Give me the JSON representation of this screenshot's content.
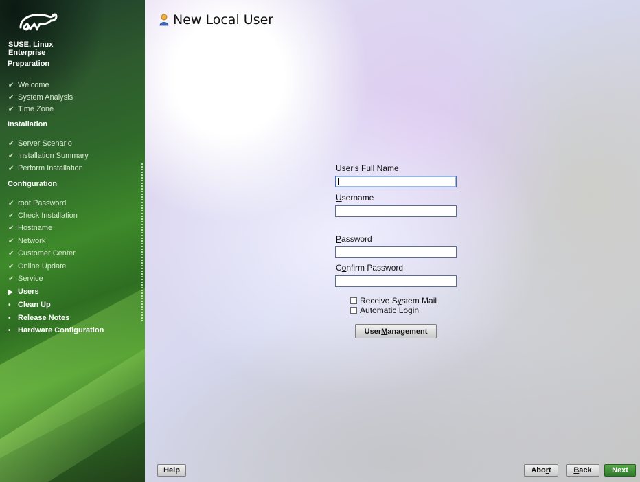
{
  "brand": {
    "line1": "SUSE. Linux",
    "line2": "Enterprise"
  },
  "sidebar": {
    "sections": [
      {
        "title": "Preparation",
        "steps": [
          {
            "label": "Welcome",
            "state": "done"
          },
          {
            "label": "System Analysis",
            "state": "done"
          },
          {
            "label": "Time Zone",
            "state": "done"
          }
        ]
      },
      {
        "title": "Installation",
        "steps": [
          {
            "label": "Server Scenario",
            "state": "done"
          },
          {
            "label": "Installation Summary",
            "state": "done"
          },
          {
            "label": "Perform Installation",
            "state": "done"
          }
        ]
      },
      {
        "title": "Configuration",
        "steps": [
          {
            "label": "root Password",
            "state": "done"
          },
          {
            "label": "Check Installation",
            "state": "done"
          },
          {
            "label": "Hostname",
            "state": "done"
          },
          {
            "label": "Network",
            "state": "done"
          },
          {
            "label": "Customer Center",
            "state": "done"
          },
          {
            "label": "Online Update",
            "state": "done"
          },
          {
            "label": "Service",
            "state": "done"
          },
          {
            "label": "Users",
            "state": "current"
          },
          {
            "label": "Clean Up",
            "state": "pending"
          },
          {
            "label": "Release Notes",
            "state": "pending"
          },
          {
            "label": "Hardware Configuration",
            "state": "pending"
          }
        ]
      }
    ],
    "marks": {
      "done": "✔",
      "current": "▶",
      "pending": "•"
    }
  },
  "page": {
    "title": "New Local User",
    "icon": "user-icon"
  },
  "form": {
    "full_name": {
      "label_pre": "User's ",
      "label_mnemonic": "F",
      "label_post": "ull Name",
      "value": ""
    },
    "username": {
      "label_pre": "",
      "label_mnemonic": "U",
      "label_post": "sername",
      "value": ""
    },
    "password": {
      "label_pre": "",
      "label_mnemonic": "P",
      "label_post": "assword",
      "value": ""
    },
    "confirm_password": {
      "label_pre": "C",
      "label_mnemonic": "o",
      "label_post": "nfirm Password",
      "value": ""
    },
    "receive_mail": {
      "label_pre": "Receive S",
      "label_mnemonic": "y",
      "label_post": "stem Mail",
      "checked": false
    },
    "auto_login": {
      "label_pre": "",
      "label_mnemonic": "A",
      "label_post": "utomatic Login",
      "checked": false
    },
    "user_mgmt": {
      "label_pre": "User ",
      "label_mnemonic": "M",
      "label_post": "anagement"
    }
  },
  "footer": {
    "help": "Help",
    "abort_pre": "Abo",
    "abort_mnemonic": "r",
    "abort_post": "t",
    "back_pre": "",
    "back_mnemonic": "B",
    "back_post": "ack",
    "next": "Next"
  },
  "colors": {
    "sidebar_green": "#2f6a2a",
    "next_button": "#3f8f36",
    "field_border": "#5a6c93"
  }
}
